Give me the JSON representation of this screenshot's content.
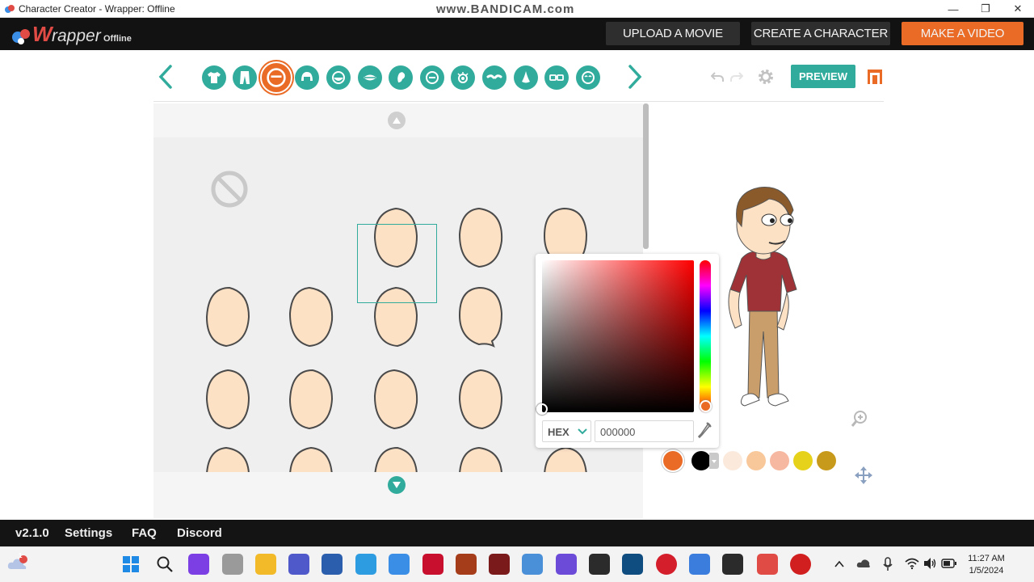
{
  "window": {
    "title": "Character Creator - Wrapper: Offline",
    "watermark": "www.BANDICAM.com",
    "minimize": "—",
    "restore": "❐",
    "close": "✕"
  },
  "header": {
    "logo_w": "W",
    "logo_rapper": "rapper",
    "logo_offline": "Offline",
    "nav": [
      "UPLOAD A MOVIE",
      "CREATE A CHARACTER",
      "MAKE A VIDEO"
    ]
  },
  "categories": {
    "items": [
      "shirt-icon",
      "pants-icon",
      "face-shape-icon",
      "hair-icon",
      "beard-icon",
      "mouth-icon",
      "ear-icon",
      "face-line-icon",
      "eye-icon",
      "eyebrow-icon",
      "nose-icon",
      "glasses-icon",
      "wrinkle-icon"
    ],
    "active": "face-shape-icon"
  },
  "toolbar": {
    "preview_label": "PREVIEW"
  },
  "color_picker": {
    "mode": "HEX",
    "hex_value": "000000"
  },
  "swatches": [
    "#ea6b26",
    "#000000",
    "#fbe9dc",
    "#f8c79a",
    "#f6b8a0",
    "#e6d21a",
    "#c89a1c"
  ],
  "footer": {
    "version": "v2.1.0",
    "settings": "Settings",
    "faq": "FAQ",
    "discord": "Discord"
  },
  "taskbar": {
    "notification_count": "1",
    "time": "11:27 AM",
    "date": "1/5/2024"
  },
  "colors": {
    "teal": "#31ab9c",
    "orange": "#ea6b26",
    "skin": "#fde1c5",
    "dark": "#121212"
  }
}
